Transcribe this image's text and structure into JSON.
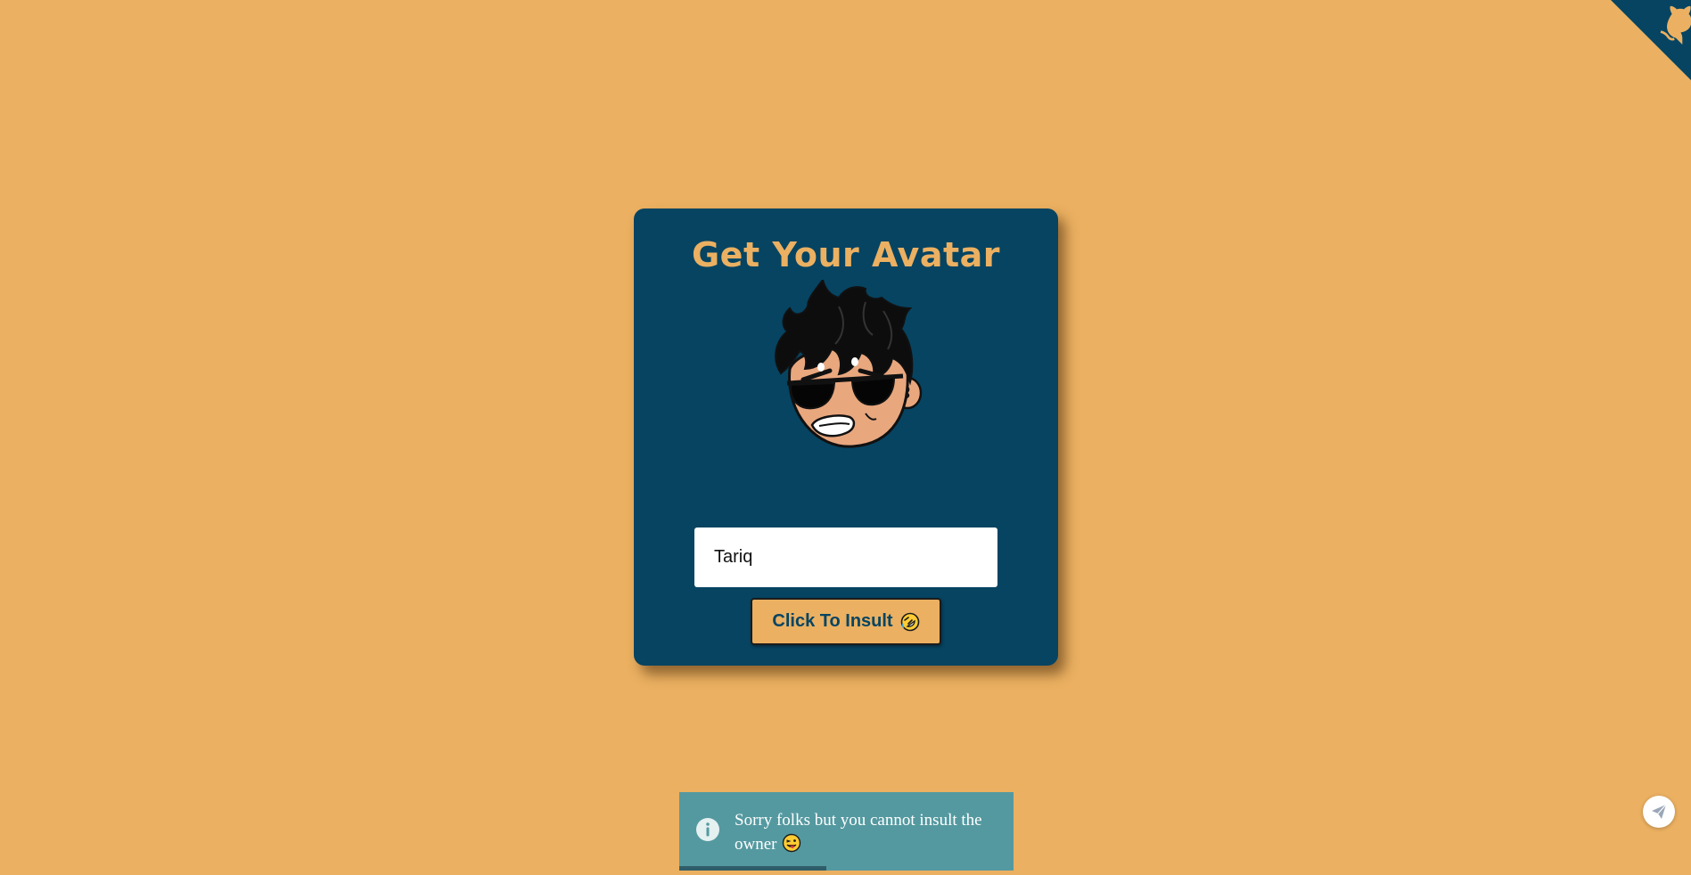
{
  "colors": {
    "background": "#EBB061",
    "card": "#064462",
    "accent": "#EBB061",
    "toast": "#5499A0"
  },
  "card": {
    "title": "Get Your Avatar",
    "avatar_icon": "cartoon-avatar-sunglasses",
    "input": {
      "value": "Tariq"
    },
    "button": {
      "label": "Click To Insult",
      "icon": "rolling-on-floor-laughing-emoji"
    }
  },
  "toast": {
    "icon": "info-icon",
    "message": "Sorry folks but you cannot insult the owner",
    "emoji": "winking-face-with-tongue-emoji",
    "progress": 0.44
  },
  "corner": {
    "icon": "github-octocat-icon"
  },
  "chat": {
    "icon": "paper-plane-icon"
  }
}
